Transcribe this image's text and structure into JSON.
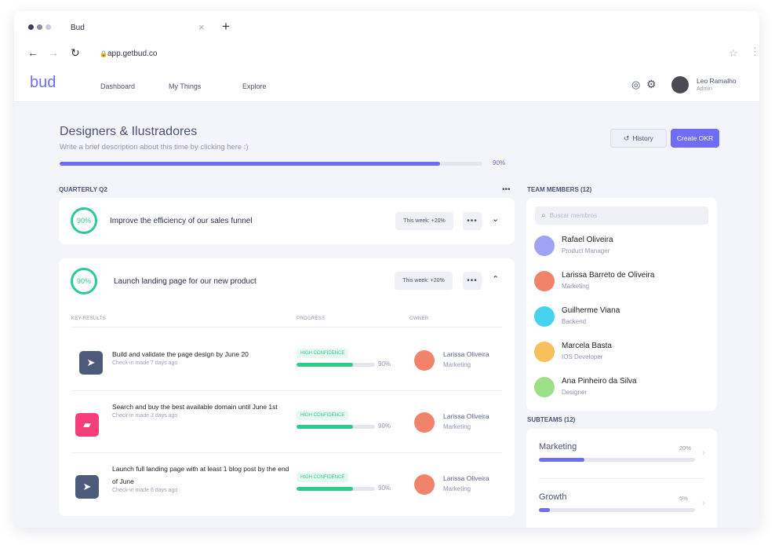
{
  "browser": {
    "tab_title": "Bud",
    "url": "app.getbud.co"
  },
  "nav": {
    "logo": "bud",
    "links": [
      "Dashboard",
      "My Things",
      "Explore"
    ],
    "user": {
      "name": "Leo Ramalho",
      "role": "Admin"
    }
  },
  "team": {
    "title": "Designers & Ilustradores",
    "description": "Write a brief description about this time by clicking here :)",
    "progress": 90,
    "progress_label": "90%",
    "history_label": "History",
    "create_label": "Create OKR"
  },
  "quarter": {
    "label": "QUARTERLY Q2"
  },
  "objectives": [
    {
      "progress_label": "90%",
      "title": "Improve the efficiency of our sales funnel",
      "week": "This week: +20%"
    },
    {
      "progress_label": "90%",
      "title": "Launch landing page for our new product",
      "week": "This week: +20%"
    }
  ],
  "kr_headers": {
    "key_results": "KEY-RESULTS",
    "progress": "PROGRESS",
    "owner": "OWNER"
  },
  "key_results": [
    {
      "title": "Build and validate the page design by June 20",
      "checkin": "Check-in made 7 days ago",
      "confidence": "HIGH CONFIDENCE",
      "progress": 90,
      "progress_label": "90%",
      "owner": "Larissa Oliveira",
      "owner_role": "Marketing",
      "icon": "paper-plane-icon",
      "color": "#4e5a7c"
    },
    {
      "title": "Search and buy the best available domain until June 1st",
      "checkin": "Check-in made 3 days ago",
      "confidence": "HIGH CONFIDENCE",
      "progress": 90,
      "progress_label": "90%",
      "owner": "Larissa Oliveira",
      "owner_role": "Marketing",
      "icon": "bookmark-icon",
      "color": "#f43f78"
    },
    {
      "title": "Launch full landing page with at least 1 blog post by the end of June",
      "checkin": "Check-in made 6 days ago",
      "confidence": "HIGH CONFIDENCE",
      "progress": 90,
      "progress_label": "90%",
      "owner": "Larissa Oliveira",
      "owner_role": "Marketing",
      "icon": "paper-plane-icon",
      "color": "#4e5a7c"
    }
  ],
  "members": {
    "title": "TEAM MEMBERS (12)",
    "search_placeholder": "Buscar membros",
    "list": [
      {
        "name": "Rafael Oliveira",
        "role": "Product Manager",
        "color": "#9fa3f5"
      },
      {
        "name": "Larissa Barreto de Oliveira",
        "role": "Marketing",
        "color": "#f2836b"
      },
      {
        "name": "Guilherme Viana",
        "role": "Backend",
        "color": "#45d3ee"
      },
      {
        "name": "Marcela Basta",
        "role": "IOS Developer",
        "color": "#f8c05a"
      },
      {
        "name": "Ana Pinheiro da Silva",
        "role": "Designer",
        "color": "#9ee08a"
      }
    ]
  },
  "subteams": {
    "title": "SUBTEAMS (12)",
    "list": [
      {
        "name": "Marketing",
        "progress": 20,
        "progress_label": "20%"
      },
      {
        "name": "Growth",
        "progress": 5,
        "progress_label": "5%"
      }
    ]
  },
  "colors": {
    "accent": "#6f6cf6",
    "green": "#2ccb8e"
  }
}
